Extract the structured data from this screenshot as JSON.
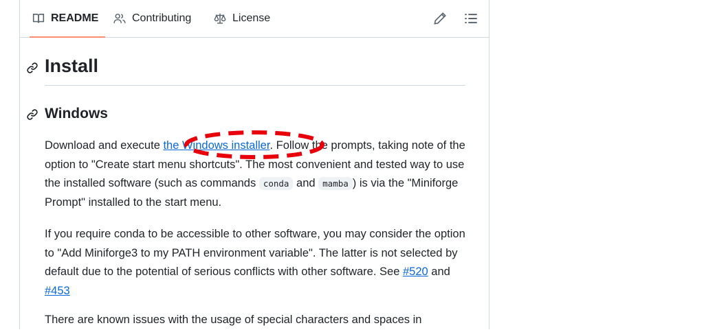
{
  "tabs": [
    {
      "label": "README",
      "icon": "book-icon",
      "active": true
    },
    {
      "label": "Contributing",
      "icon": "people-icon",
      "active": false
    },
    {
      "label": "License",
      "icon": "law-icon",
      "active": false
    }
  ],
  "toolbar": {
    "edit_icon": "pencil-icon",
    "outline_icon": "list-icon"
  },
  "content": {
    "h1": "Install",
    "h2": "Windows",
    "p1": {
      "t1": "Download and execute ",
      "link": "the Windows installer",
      "t2": ". Follow the prompts, taking note of the option to \"Create start menu shortcuts\". The most convenient and tested way to use the installed software (such as commands ",
      "code1": "conda",
      "t3": " and ",
      "code2": "mamba",
      "t4": ") is via the \"Miniforge Prompt\" installed to the start menu."
    },
    "p2": {
      "t1": "If you require conda to be accessible to other software, you may consider the option to \"Add Miniforge3 to my PATH environment variable\". The latter is not selected by default due to the potential of serious conflicts with other software. See ",
      "link1": "#520",
      "t2": " and ",
      "link2": "#453"
    },
    "p3": "There are known issues with the usage of special characters and spaces in"
  },
  "colors": {
    "accent_tab": "#fd8c73",
    "link": "#0969da",
    "annotation": "#e8000b"
  }
}
